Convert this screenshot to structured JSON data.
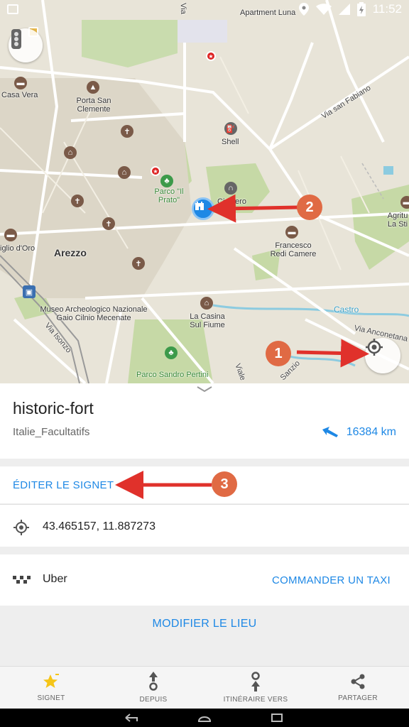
{
  "status_bar": {
    "time": "11:52"
  },
  "map": {
    "labels": {
      "apartment_luna": "Apartment Luna",
      "casa_vera": "Casa Vera",
      "porta_san_clemente": "Porta San Clemente",
      "via_san_fabiano": "Via san Fabiano",
      "shell": "Shell",
      "parco_il_prato": "Parco \"Il Prato\"",
      "cimitero": "Cimitero",
      "francesco_redi": "Francesco Redi Camere",
      "arezzo": "Arezzo",
      "giglio_doro": "iglio d'Oro",
      "museo": "Museo Archeologico Nazionale Gaio Cilnio Mecenate",
      "la_casina": "La Casina Sul Fiume",
      "castro": "Castro",
      "via_anconetana": "Via Anconetana",
      "via_isonzo": "Via Isonzo",
      "parco_sandro": "Parco Sandro Pertini",
      "agritu": "Agritu La Sti",
      "vialg": "Viale",
      "sanzio": "Sanzio",
      "via_top": "Via"
    },
    "annotations": [
      "1",
      "2",
      "3"
    ]
  },
  "place": {
    "title": "historic-fort",
    "category": "Italie_Facultatifs",
    "distance": "16384 km",
    "edit_label": "ÉDITER LE SIGNET",
    "coordinates": "43.465157, 11.887273",
    "uber_label": "Uber",
    "taxi_label": "COMMANDER UN TAXI",
    "modify_label": "MODIFIER LE LIEU"
  },
  "bottom_nav": [
    {
      "label": "SIGNET",
      "icon": "star-icon"
    },
    {
      "label": "DEPUIS",
      "icon": "route-from-icon"
    },
    {
      "label": "ITINÉRAIRE VERS",
      "icon": "route-to-icon"
    },
    {
      "label": "PARTAGER",
      "icon": "share-icon"
    }
  ],
  "colors": {
    "accent": "#1e88e5",
    "annotation": "#e06a44",
    "arrow": "#e0312b",
    "star": "#f5c518"
  }
}
